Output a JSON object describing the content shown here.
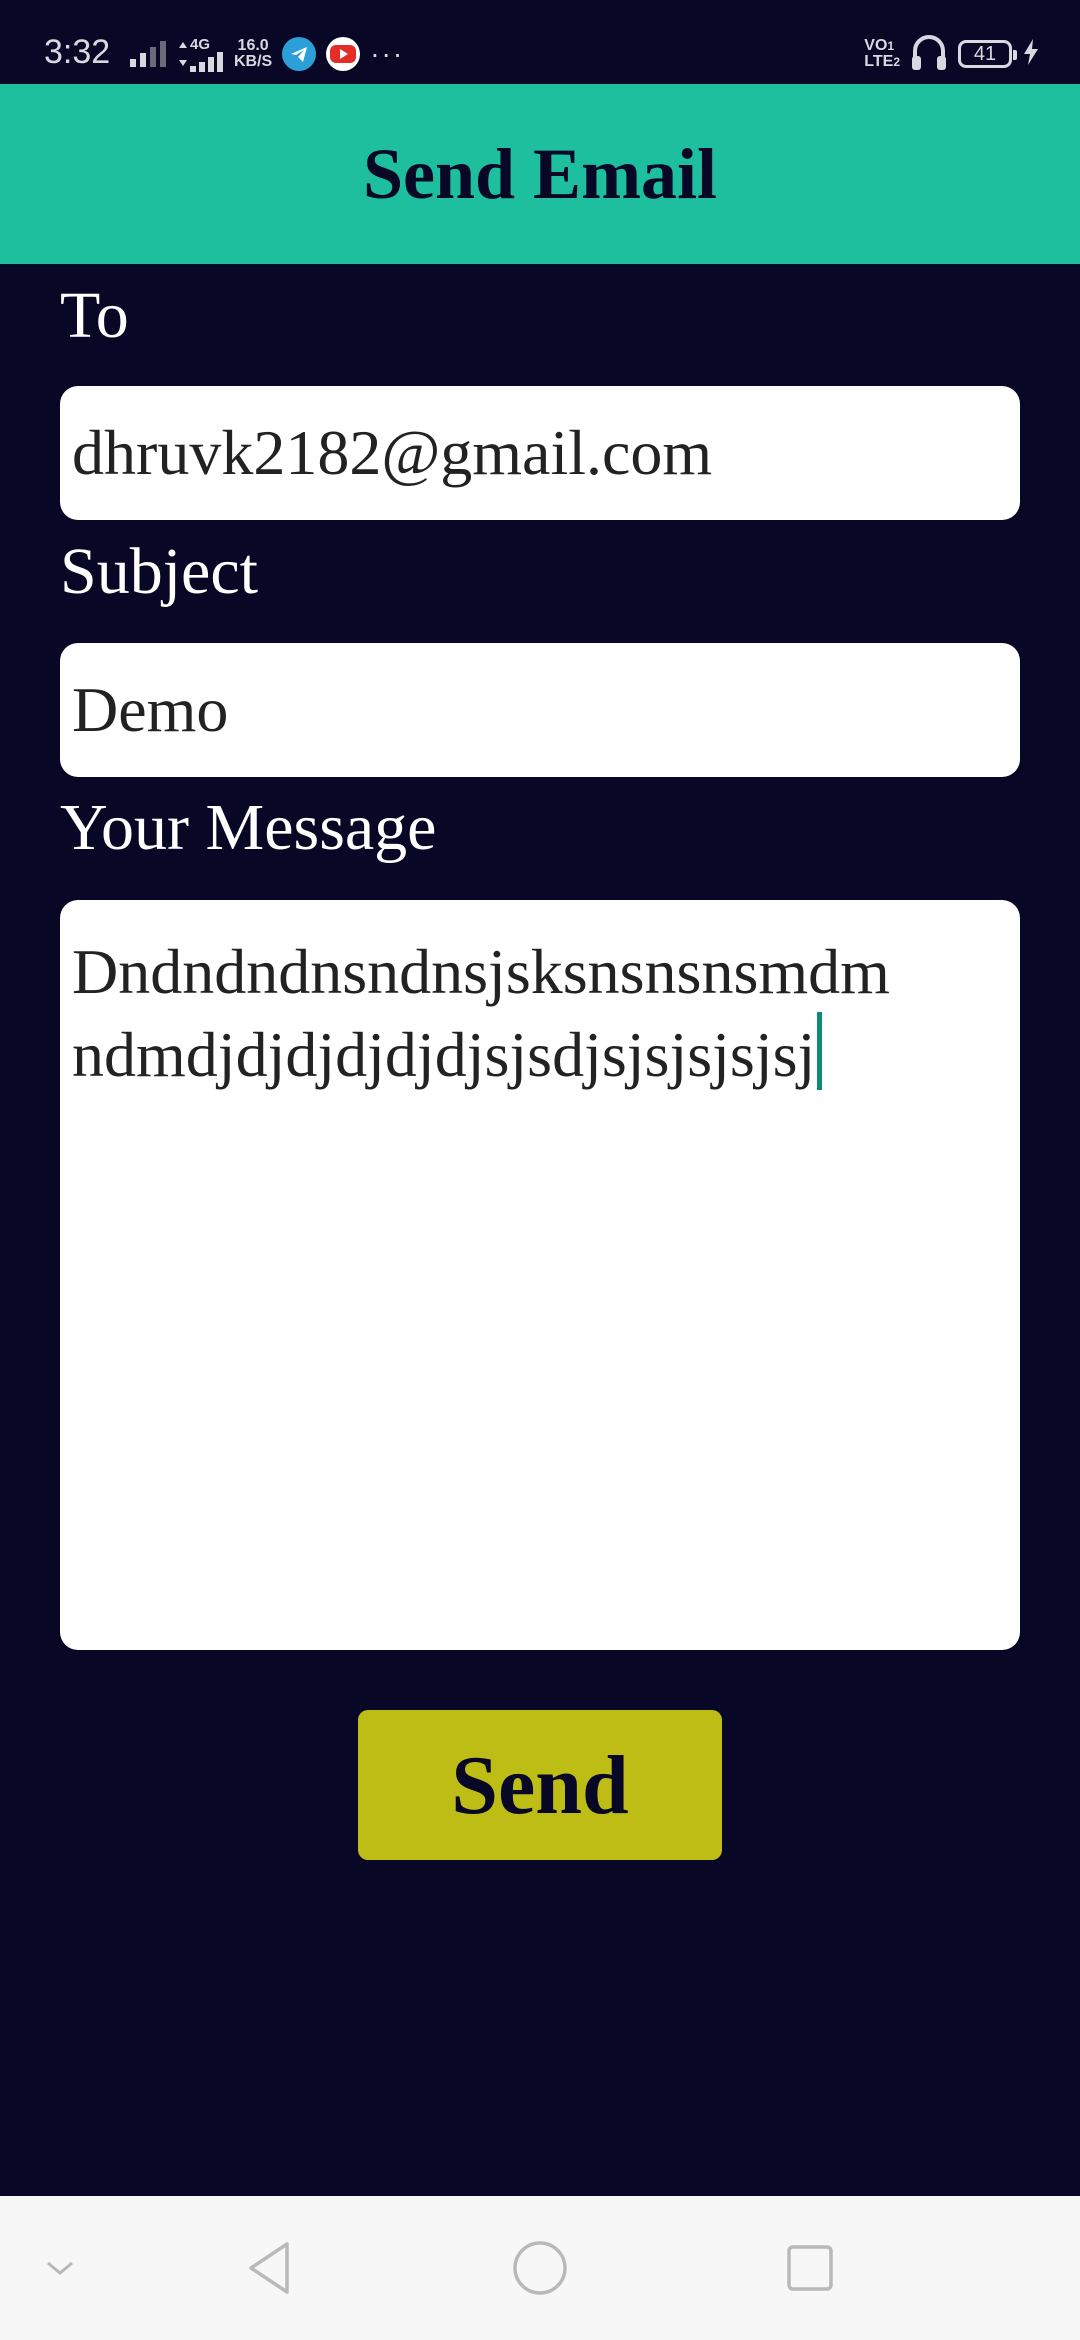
{
  "status_bar": {
    "time": "3:32",
    "network_type": "4G",
    "speed_value": "16.0",
    "speed_unit": "KB/S",
    "more": "···",
    "volte_top": "VO",
    "volte_bottom": "LTE",
    "sim1": "1",
    "sim2": "2",
    "battery_level": "41",
    "icons": [
      "signal-icon",
      "data-arrows-icon",
      "signal-4g-icon",
      "telegram-icon",
      "youtube-icon",
      "headphones-icon",
      "battery-icon",
      "charging-icon"
    ]
  },
  "app_bar": {
    "title": "Send Email",
    "color": "#1dbf9e"
  },
  "form": {
    "to_label": "To",
    "to_value": "dhruvk2182@gmail.com",
    "subject_label": "Subject",
    "subject_value": "Demo",
    "message_label": "Your Message",
    "message_line1": "Dndndndnsndnsjsksnsnsnsmdm",
    "message_line2": "ndmdjdjdjdjdjdjsjsdjsjsjsjsjsj"
  },
  "send_button": {
    "label": "Send",
    "color": "#bebd16"
  },
  "nav_bar": {
    "icons": [
      "chevron-down-icon",
      "back-icon",
      "home-icon",
      "recents-icon"
    ]
  },
  "colors": {
    "background": "#080826",
    "field": "#ffffff",
    "caret": "#0d8a7a"
  }
}
